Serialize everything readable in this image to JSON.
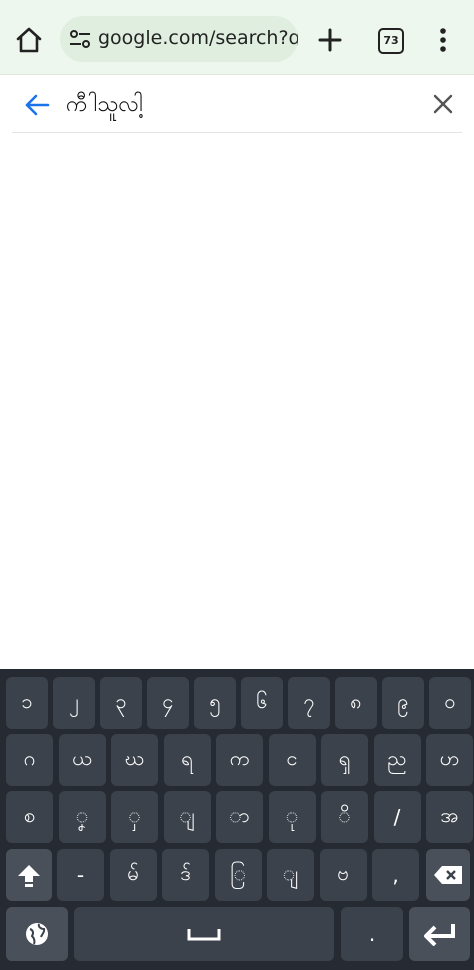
{
  "browser": {
    "url": "google.com/search?q",
    "tab_count": "73",
    "icons": {
      "home": "home-icon",
      "site_settings": "tune-icon",
      "new_tab": "plus-icon",
      "menu": "more-vert-icon"
    }
  },
  "search": {
    "query": "ကီါသူလါ့",
    "back_icon": "arrow-back-icon",
    "clear_icon": "close-icon",
    "accent_color": "#1a73e8"
  },
  "keyboard": {
    "row1": [
      "၁",
      "၂",
      "၃",
      "၄",
      "၅",
      "၆",
      "၇",
      "၈",
      "၉",
      "၀"
    ],
    "row2": [
      "ဂ",
      "ယ",
      "ဃ",
      "ရ",
      "က",
      "င",
      "ၡ",
      "ည",
      "ဟ"
    ],
    "row3": [
      "စ",
      "ၞ",
      "ှ",
      "ျ",
      "ာ",
      "ု",
      "ိ",
      "/",
      "အ"
    ],
    "row4": [
      "-",
      "မ်",
      "ဒ်",
      "ြ",
      "ျ",
      "ဗ",
      ","
    ],
    "space_label": "⎵",
    "period": ".",
    "icons": {
      "shift": "shift-icon",
      "backspace": "backspace-icon",
      "language": "globe-icon",
      "enter": "enter-icon"
    }
  }
}
